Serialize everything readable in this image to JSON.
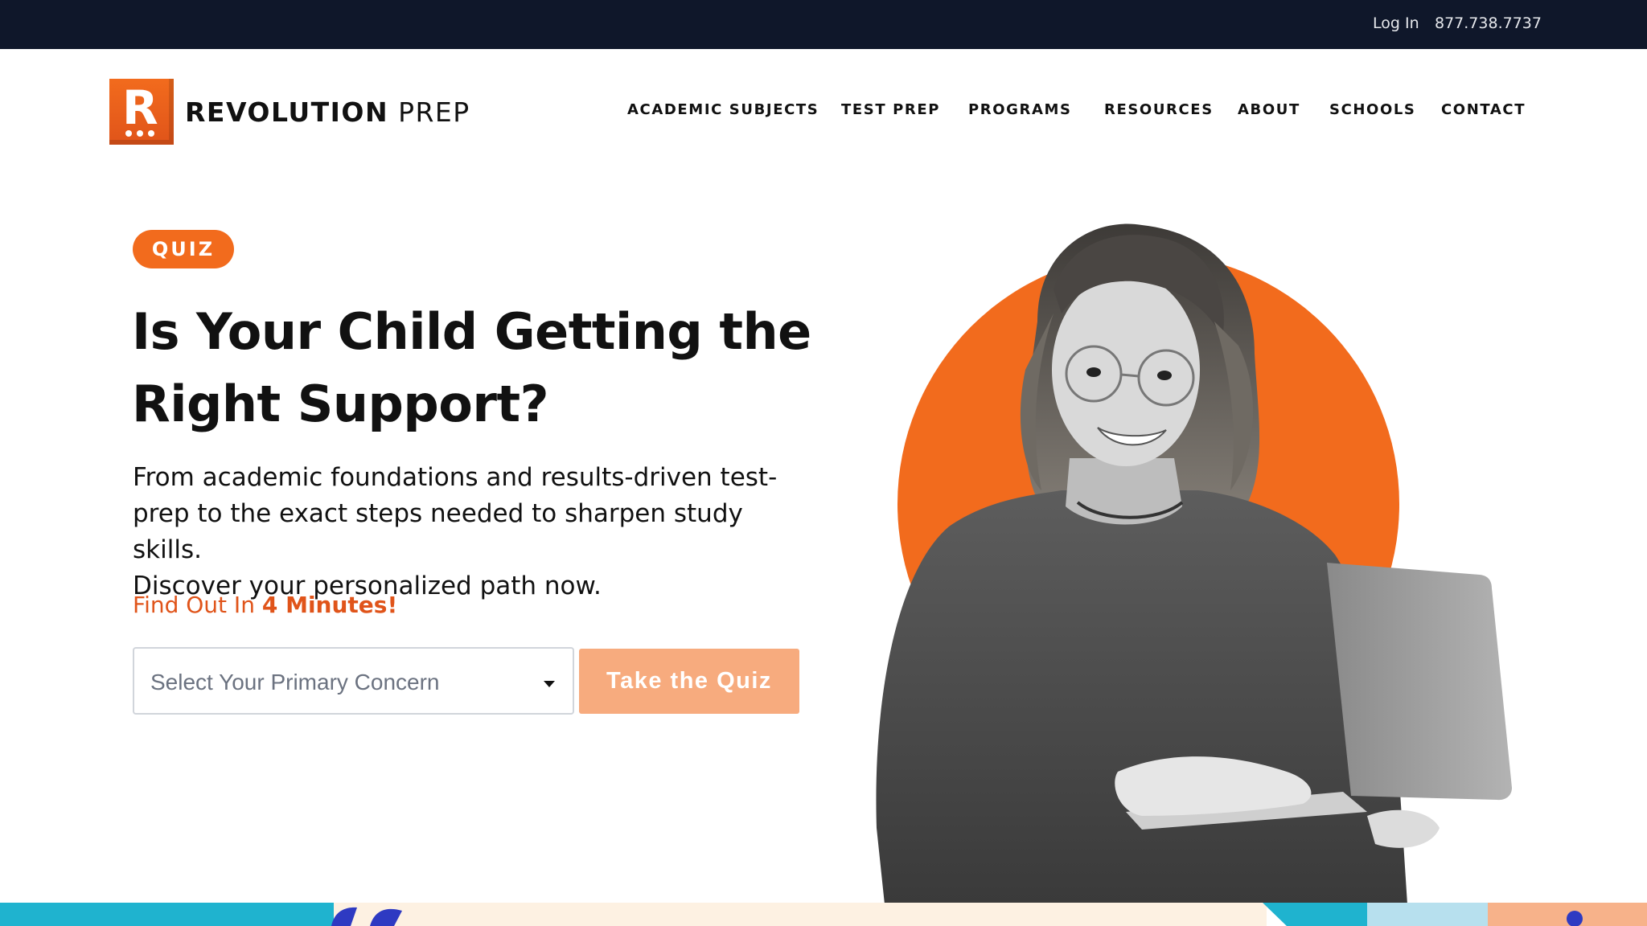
{
  "topbar": {
    "login": "Log In",
    "phone": "877.738.7737"
  },
  "brand": {
    "logo_letter": "R",
    "name_bold": "REVOLUTION",
    "name_light": " PREP"
  },
  "nav": [
    {
      "label": "ACADEMIC SUBJECTS"
    },
    {
      "label": "TEST PREP"
    },
    {
      "label": "PROGRAMS"
    },
    {
      "label": "RESOURCES"
    },
    {
      "label": "ABOUT"
    },
    {
      "label": "SCHOOLS"
    },
    {
      "label": "CONTACT"
    }
  ],
  "hero": {
    "badge": "QUIZ",
    "headline_line1": "Is Your Child Getting the",
    "headline_line2": "Right Support?",
    "lede_line1": "From academic foundations and results-driven test-",
    "lede_line2": "prep to the exact steps needed to sharpen study skills.",
    "lede_line3": "Discover your personalized path now.",
    "findout_prefix": "Find Out In ",
    "findout_strong": "4 Minutes!",
    "select_placeholder": "Select Your Primary Concern",
    "cta": "Take the Quiz"
  },
  "colors": {
    "accent": "#f26b1d",
    "accent_dark": "#e0541a",
    "cta_disabled": "#f7ab7e",
    "topbar": "#0f172a",
    "strip_teal": "#1fb3cf",
    "strip_cream": "#fdf1e2"
  },
  "icons": [
    "chevron-down-icon"
  ]
}
